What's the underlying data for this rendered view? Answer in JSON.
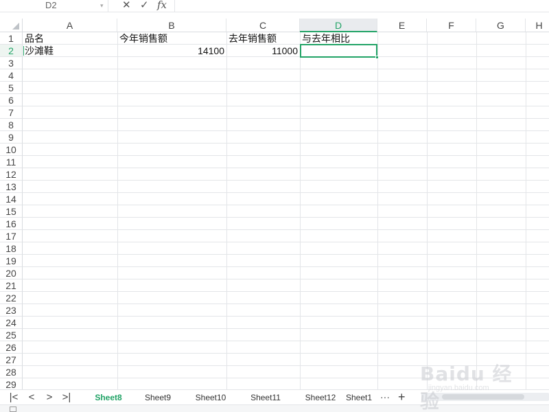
{
  "formula_bar": {
    "name_box": "D2",
    "cancel_icon": "✕",
    "confirm_icon": "✓",
    "fx_label": "fx",
    "formula": ""
  },
  "columns": [
    "A",
    "B",
    "C",
    "D",
    "E",
    "F",
    "G",
    "H"
  ],
  "active_column": "D",
  "rows": [
    "1",
    "2",
    "3",
    "4",
    "5",
    "6",
    "7",
    "8",
    "9",
    "10",
    "11",
    "12",
    "13",
    "14",
    "15",
    "16",
    "17",
    "18",
    "19",
    "20",
    "21",
    "22",
    "23",
    "24",
    "25",
    "26",
    "27",
    "28",
    "29"
  ],
  "active_row": "2",
  "cells": {
    "A1": "品名",
    "B1": "今年销售额",
    "C1": "去年销售额",
    "D1": "与去年相比",
    "A2": "沙滩鞋",
    "B2": "14100",
    "C2": "11000",
    "D2": ""
  },
  "sheet_nav": {
    "first": "|<",
    "prev": "<",
    "next": ">",
    "last": ">|"
  },
  "sheets": [
    "Sheet8",
    "Sheet9",
    "Sheet10",
    "Sheet11",
    "Sheet12",
    "Sheet1"
  ],
  "active_sheet": "Sheet8",
  "more_sheets": "···",
  "add_sheet": "+",
  "watermark": {
    "logo": "Baidu 经验",
    "url": "jingyan.baidu.com"
  },
  "colors": {
    "accent": "#21a366",
    "gridline": "#e3e5e8"
  }
}
